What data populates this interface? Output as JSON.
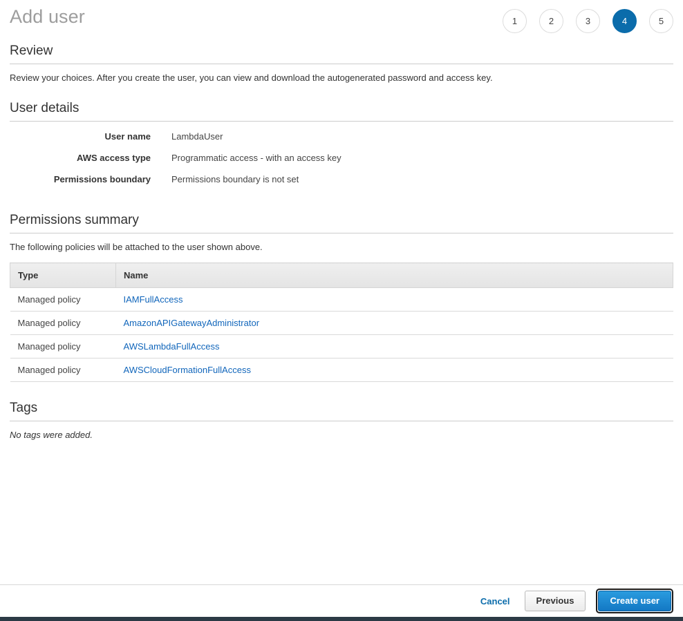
{
  "header": {
    "title": "Add user",
    "steps": [
      {
        "label": "1",
        "active": false
      },
      {
        "label": "2",
        "active": false
      },
      {
        "label": "3",
        "active": false
      },
      {
        "label": "4",
        "active": true
      },
      {
        "label": "5",
        "active": false
      }
    ]
  },
  "review": {
    "heading": "Review",
    "description": "Review your choices. After you create the user, you can view and download the autogenerated password and access key."
  },
  "user_details": {
    "heading": "User details",
    "rows": [
      {
        "label": "User name",
        "value": "LambdaUser"
      },
      {
        "label": "AWS access type",
        "value": "Programmatic access - with an access key"
      },
      {
        "label": "Permissions boundary",
        "value": "Permissions boundary is not set"
      }
    ]
  },
  "permissions_summary": {
    "heading": "Permissions summary",
    "description": "The following policies will be attached to the user shown above.",
    "columns": [
      "Type",
      "Name"
    ],
    "rows": [
      {
        "type": "Managed policy",
        "name": "IAMFullAccess"
      },
      {
        "type": "Managed policy",
        "name": "AmazonAPIGatewayAdministrator"
      },
      {
        "type": "Managed policy",
        "name": "AWSLambdaFullAccess"
      },
      {
        "type": "Managed policy",
        "name": "AWSCloudFormationFullAccess"
      }
    ]
  },
  "tags": {
    "heading": "Tags",
    "empty_text": "No tags were added."
  },
  "footer": {
    "cancel_label": "Cancel",
    "previous_label": "Previous",
    "create_label": "Create user"
  },
  "colors": {
    "accent_blue": "#0b6cab",
    "link_blue": "#1166bb",
    "primary_button": "#1378c4",
    "title_gray": "#9d9d9d",
    "bottom_bar": "#2b3a45"
  }
}
